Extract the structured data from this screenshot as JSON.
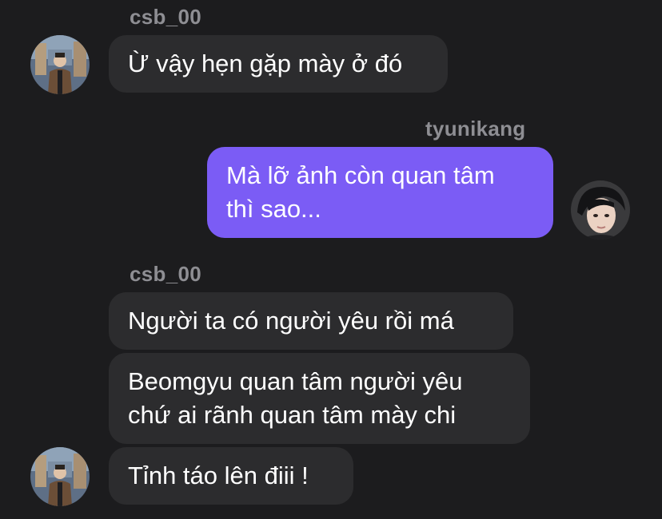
{
  "colors": {
    "background": "#1c1c1e",
    "incoming_bubble": "#2c2c2e",
    "outgoing_bubble": "#7b5cf5",
    "sender_name": "#8e8e93",
    "text": "#ffffff"
  },
  "thread": {
    "group1": {
      "sender": "csb_00",
      "messages": [
        "Ừ vậy hẹn gặp mày ở đó"
      ]
    },
    "group2": {
      "sender": "tyunikang",
      "messages": [
        "Mà lỡ ảnh còn quan tâm\nthì sao..."
      ]
    },
    "group3": {
      "sender": "csb_00",
      "messages": [
        "Người ta có người yêu rồi má",
        "Beomgyu quan tâm người yêu\nchứ ai rãnh quan tâm mày chi",
        "Tỉnh táo lên điii !"
      ]
    }
  },
  "icons": {
    "incoming_avatar": "user-avatar-photo",
    "outgoing_avatar": "user-avatar-photo"
  }
}
